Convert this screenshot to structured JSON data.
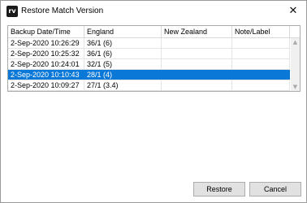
{
  "window": {
    "title": "Restore Match Version",
    "app_icon_text": "rv",
    "close_glyph": "✕"
  },
  "table": {
    "columns": [
      "Backup Date/Time",
      "England",
      "New Zealand",
      "Note/Label"
    ],
    "rows": [
      {
        "datetime": "2-Sep-2020 10:26:29",
        "england": "36/1 (6)",
        "new_zealand": "",
        "note": ""
      },
      {
        "datetime": "2-Sep-2020 10:25:32",
        "england": "36/1 (6)",
        "new_zealand": "",
        "note": ""
      },
      {
        "datetime": "2-Sep-2020 10:24:01",
        "england": "32/1 (5)",
        "new_zealand": "",
        "note": ""
      },
      {
        "datetime": "2-Sep-2020 10:10:43",
        "england": "28/1 (4)",
        "new_zealand": "",
        "note": ""
      },
      {
        "datetime": "2-Sep-2020 10:09:27",
        "england": "27/1 (3.4)",
        "new_zealand": "",
        "note": ""
      }
    ],
    "selected_row": 3,
    "scroll_up_glyph": "▲",
    "scroll_down_glyph": "▼"
  },
  "buttons": {
    "restore_label": "Restore",
    "cancel_label": "Cancel"
  },
  "colors": {
    "selection": "#0a78d7"
  }
}
